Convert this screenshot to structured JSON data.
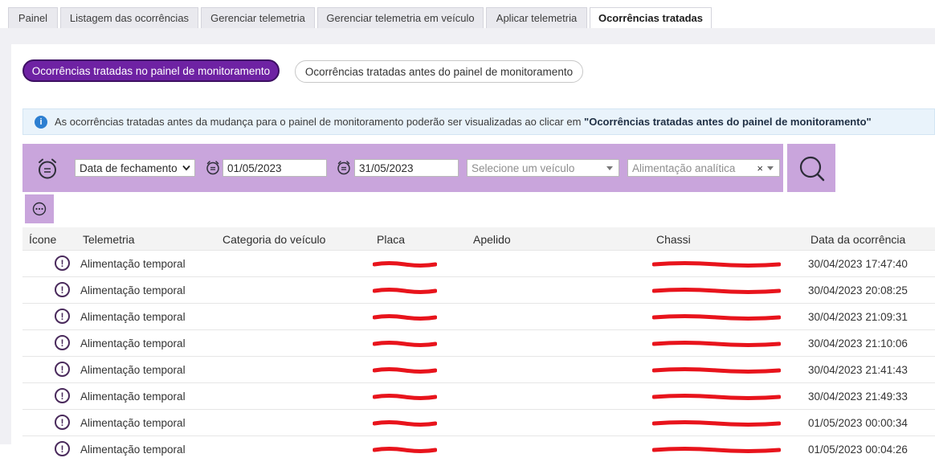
{
  "tabs": [
    {
      "label": "Painel",
      "active": false
    },
    {
      "label": "Listagem das ocorrências",
      "active": false
    },
    {
      "label": "Gerenciar telemetria",
      "active": false
    },
    {
      "label": "Gerenciar telemetria em veículo",
      "active": false
    },
    {
      "label": "Aplicar telemetria",
      "active": false
    },
    {
      "label": "Ocorrências tratadas",
      "active": true
    }
  ],
  "subtabs": {
    "active": "Ocorrências tratadas no painel de monitoramento",
    "inactive": "Ocorrências tratadas antes do painel de monitoramento"
  },
  "info": {
    "text": "As ocorrências tratadas antes da mudança para o painel de monitoramento poderão ser visualizadas ao clicar em ",
    "link": "\"Ocorrências tratadas antes do painel de monitoramento\""
  },
  "filters": {
    "date_type": "Data de fechamento",
    "date_start": "01/05/2023",
    "date_end": "31/05/2023",
    "vehicle_placeholder": "Selecione um veículo",
    "telemetry": "Alimentação analítica",
    "clear_symbol": "×"
  },
  "table": {
    "headers": [
      "Ícone",
      "Telemetria",
      "Categoria do veículo",
      "Placa",
      "Apelido",
      "Chassi",
      "Data da ocorrência"
    ],
    "rows": [
      {
        "telemetria": "Alimentação temporal",
        "categoria": "",
        "apelido": "",
        "data": "30/04/2023 17:47:40"
      },
      {
        "telemetria": "Alimentação temporal",
        "categoria": "",
        "apelido": "",
        "data": "30/04/2023 20:08:25"
      },
      {
        "telemetria": "Alimentação temporal",
        "categoria": "",
        "apelido": "",
        "data": "30/04/2023 21:09:31"
      },
      {
        "telemetria": "Alimentação temporal",
        "categoria": "",
        "apelido": "",
        "data": "30/04/2023 21:10:06"
      },
      {
        "telemetria": "Alimentação temporal",
        "categoria": "",
        "apelido": "",
        "data": "30/04/2023 21:41:43"
      },
      {
        "telemetria": "Alimentação temporal",
        "categoria": "",
        "apelido": "",
        "data": "30/04/2023 21:49:33"
      },
      {
        "telemetria": "Alimentação temporal",
        "categoria": "",
        "apelido": "",
        "data": "01/05/2023 00:00:34"
      },
      {
        "telemetria": "Alimentação temporal",
        "categoria": "",
        "apelido": "",
        "data": "01/05/2023 00:04:26"
      }
    ],
    "icon_glyph": "!"
  },
  "colors": {
    "accent": "#6e22a3",
    "filter_bg": "#c9a5dc",
    "info_bg": "#e9f3fb",
    "info_icon": "#2d7fd1",
    "redaction": "#e8141c"
  },
  "icons": {
    "alarm_clock": "alarm-clock-icon",
    "calendar": "calendar-icon",
    "search": "search-icon",
    "more": "more-icon",
    "warning": "warning-icon"
  }
}
